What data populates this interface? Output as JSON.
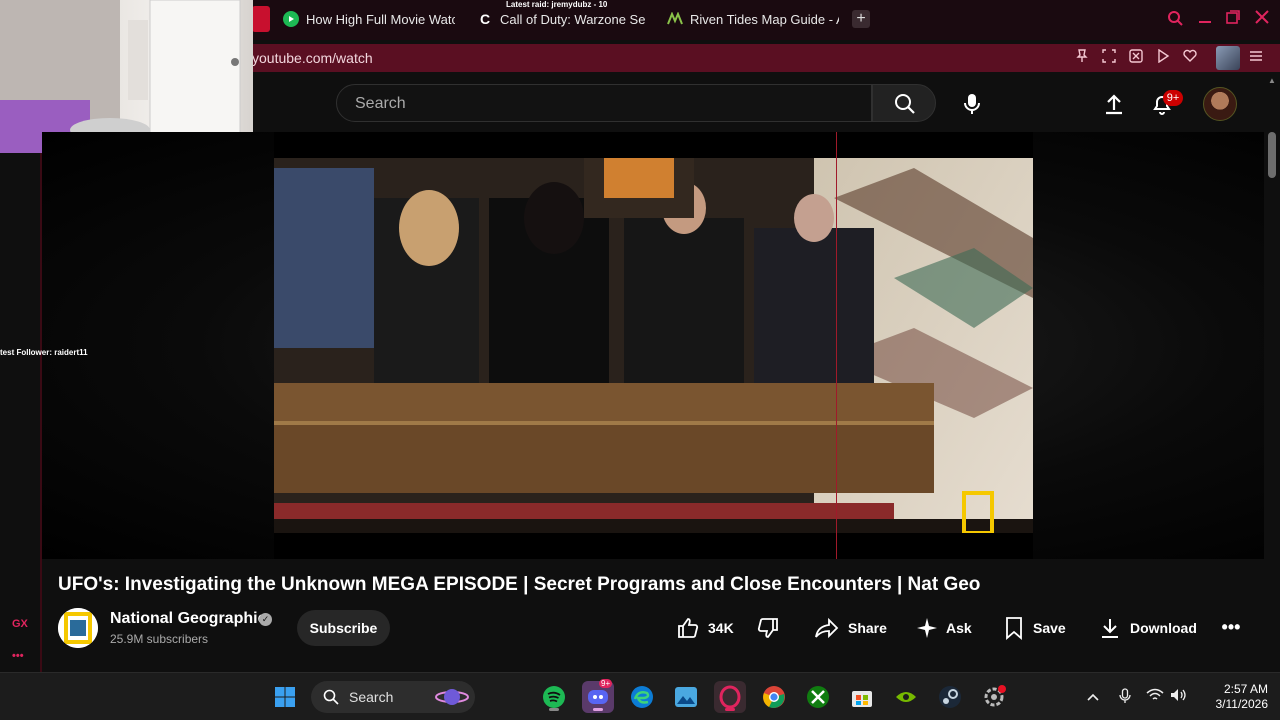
{
  "browser": {
    "tabs": [
      {
        "label": "How High Full Movie Watc",
        "icon": "play-circle-icon",
        "color": "#1db954"
      },
      {
        "label": "Call of Duty: Warzone Sea",
        "icon": "c-logo-icon",
        "color": "#ffffff"
      },
      {
        "label": "Riven Tides Map Guide - A",
        "icon": "leaf-logo-icon",
        "color": "#8bc34a"
      }
    ],
    "url": "youtube.com/watch",
    "accent": "#e0245e"
  },
  "stream_overlay": {
    "raid": "Latest raid: jremydubz - 10",
    "follower": "test Follower: raidert11",
    "gx": "GX",
    "gx_more": "•••"
  },
  "youtube": {
    "search_placeholder": "Search",
    "notification_count": "9+",
    "video_title": "UFO's: Investigating the Unknown MEGA EPISODE | Secret Programs and Close Encounters | Nat Geo",
    "channel": {
      "name": "National Geographic",
      "subscribers": "25.9M subscribers",
      "subscribe_label": "Subscribe"
    },
    "actions": {
      "likes": "34K",
      "share": "Share",
      "ask": "Ask",
      "save": "Save",
      "download": "Download"
    }
  },
  "taskbar": {
    "search_label": "Search",
    "discord_badge": "9+",
    "time": "2:57 AM",
    "date": "3/11/2026",
    "apps": [
      "windows-start-icon",
      "spotify-icon",
      "discord-icon",
      "edge-icon",
      "photos-icon",
      "opera-gx-icon",
      "chrome-icon",
      "xbox-icon",
      "microsoft-store-icon",
      "nvidia-icon",
      "steam-icon",
      "settings-icon"
    ]
  }
}
